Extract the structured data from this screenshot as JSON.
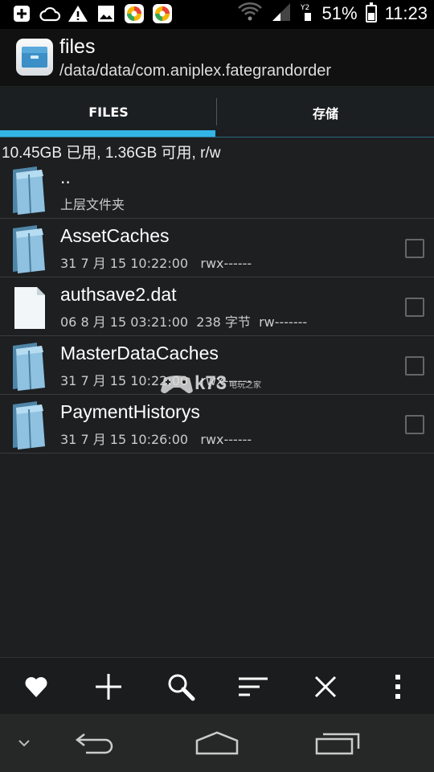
{
  "status_bar": {
    "battery_percent": "51%",
    "battery_level": 0.51,
    "time": "11:23",
    "icons": [
      "plus-box-icon",
      "cloud-icon",
      "warning-icon",
      "image-icon",
      "app-icon-1",
      "app-icon-2",
      "wifi-icon",
      "signal-icon",
      "data-icon",
      "battery-icon"
    ]
  },
  "header": {
    "title": "files",
    "path": "/data/data/com.aniplex.fategrandorder",
    "icon": "file-manager-icon"
  },
  "tabs": [
    {
      "label": "FILES",
      "active": true
    },
    {
      "label": "存储",
      "active": false
    }
  ],
  "disk_info": "10.45GB 已用, 1.36GB 可用, r/w",
  "files": [
    {
      "type": "folder",
      "name": "..",
      "meta": "上层文件夹",
      "checkbox": false
    },
    {
      "type": "folder",
      "name": "AssetCaches",
      "meta": "31 7 月 15 10:22:00   rwx------",
      "checkbox": true
    },
    {
      "type": "file",
      "name": "authsave2.dat",
      "meta": "06 8 月 15 03:21:00  238 字节  rw-------",
      "checkbox": true
    },
    {
      "type": "folder",
      "name": "MasterDataCaches",
      "meta": "31 7 月 15 10:22:00   rwx------",
      "checkbox": true
    },
    {
      "type": "folder",
      "name": "PaymentHistorys",
      "meta": "31 7 月 15 10:26:00   rwx------",
      "checkbox": true
    }
  ],
  "toolbar": {
    "buttons": [
      "favorite-heart-icon",
      "add-plus-icon",
      "search-icon",
      "sort-icon",
      "close-icon",
      "overflow-menu-icon"
    ]
  },
  "watermark": {
    "text": "k73",
    "small": "电玩之家"
  },
  "colors": {
    "accent": "#33b5e5",
    "background": "#1d1f21",
    "folder": "#6aa6c8"
  }
}
